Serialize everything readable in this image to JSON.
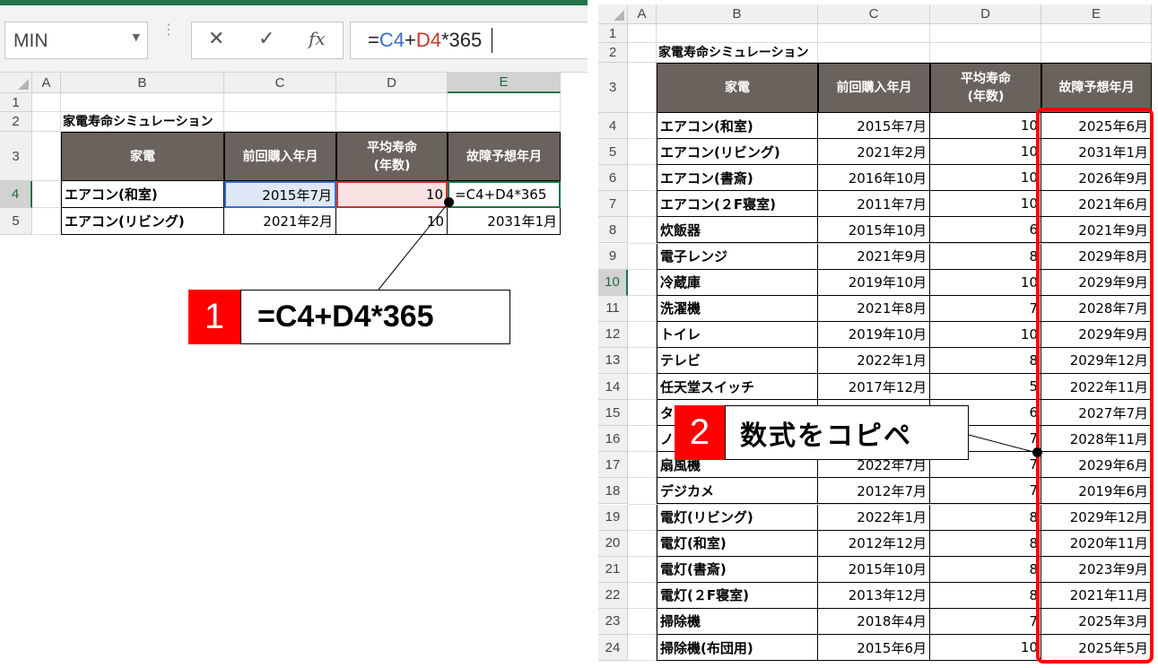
{
  "formula_bar": {
    "name_box": "MIN",
    "cancel_icon": "✕",
    "enter_icon": "✓",
    "fx_label": "fx",
    "formula": {
      "eq": "=",
      "ref_c": "C4",
      "plus": "+",
      "ref_d": "D4",
      "rest": "*365"
    }
  },
  "columns_left": [
    "A",
    "B",
    "C",
    "D",
    "E"
  ],
  "columns_right": [
    "A",
    "B",
    "C",
    "D",
    "E"
  ],
  "sheet_title": "家電寿命シミュレーション",
  "table_headers": [
    "家電",
    "前回購入年月",
    "平均寿命\n(年数)",
    "故障予想年月"
  ],
  "left_rows": [
    {
      "row": "4",
      "name": "エアコン(和室)",
      "purchase": "2015年7月",
      "life": "10",
      "failure": "=C4+D4*365"
    },
    {
      "row": "5",
      "name": "エアコン(リビング)",
      "purchase": "2021年2月",
      "life": "10",
      "failure": "2031年1月"
    }
  ],
  "right_rows": [
    {
      "row": "4",
      "name": "エアコン(和室)",
      "purchase": "2015年7月",
      "life": "10",
      "failure": "2025年6月"
    },
    {
      "row": "5",
      "name": "エアコン(リビング)",
      "purchase": "2021年2月",
      "life": "10",
      "failure": "2031年1月"
    },
    {
      "row": "6",
      "name": "エアコン(書斎)",
      "purchase": "2016年10月",
      "life": "10",
      "failure": "2026年9月"
    },
    {
      "row": "7",
      "name": "エアコン(２F寝室)",
      "purchase": "2011年7月",
      "life": "10",
      "failure": "2021年6月"
    },
    {
      "row": "8",
      "name": "炊飯器",
      "purchase": "2015年10月",
      "life": "6",
      "failure": "2021年9月"
    },
    {
      "row": "9",
      "name": "電子レンジ",
      "purchase": "2021年9月",
      "life": "8",
      "failure": "2029年8月"
    },
    {
      "row": "10",
      "name": "冷蔵庫",
      "purchase": "2019年10月",
      "life": "10",
      "failure": "2029年9月"
    },
    {
      "row": "11",
      "name": "洗濯機",
      "purchase": "2021年8月",
      "life": "7",
      "failure": "2028年7月"
    },
    {
      "row": "12",
      "name": "トイレ",
      "purchase": "2019年10月",
      "life": "10",
      "failure": "2029年9月"
    },
    {
      "row": "13",
      "name": "テレビ",
      "purchase": "2022年1月",
      "life": "8",
      "failure": "2029年12月"
    },
    {
      "row": "14",
      "name": "任天堂スイッチ",
      "purchase": "2017年12月",
      "life": "5",
      "failure": "2022年11月"
    },
    {
      "row": "15",
      "name": "タ",
      "purchase": "",
      "life": "6",
      "failure": "2027年7月"
    },
    {
      "row": "16",
      "name": "ノ",
      "purchase": "",
      "life": "7",
      "failure": "2028年11月"
    },
    {
      "row": "17",
      "name": "扇風機",
      "purchase": "2022年7月",
      "life": "7",
      "failure": "2029年6月"
    },
    {
      "row": "18",
      "name": "デジカメ",
      "purchase": "2012年7月",
      "life": "7",
      "failure": "2019年6月"
    },
    {
      "row": "19",
      "name": "電灯(リビング)",
      "purchase": "2022年1月",
      "life": "8",
      "failure": "2029年12月"
    },
    {
      "row": "20",
      "name": "電灯(和室)",
      "purchase": "2012年12月",
      "life": "8",
      "failure": "2020年11月"
    },
    {
      "row": "21",
      "name": "電灯(書斎)",
      "purchase": "2015年10月",
      "life": "8",
      "failure": "2023年9月"
    },
    {
      "row": "22",
      "name": "電灯(２F寝室)",
      "purchase": "2013年12月",
      "life": "8",
      "failure": "2021年11月"
    },
    {
      "row": "23",
      "name": "掃除機",
      "purchase": "2018年4月",
      "life": "7",
      "failure": "2025年3月"
    },
    {
      "row": "24",
      "name": "掃除機(布団用)",
      "purchase": "2015年6月",
      "life": "10",
      "failure": "2025年5月"
    }
  ],
  "callout1": {
    "number": "1",
    "text": "=C4+D4*365"
  },
  "callout2": {
    "number": "2",
    "text": "数式をコピペ"
  },
  "colors": {
    "header_bg": "#69625d",
    "excel_green": "#217346",
    "callout_red": "#ff0000",
    "highlight_red": "#ff0000"
  }
}
